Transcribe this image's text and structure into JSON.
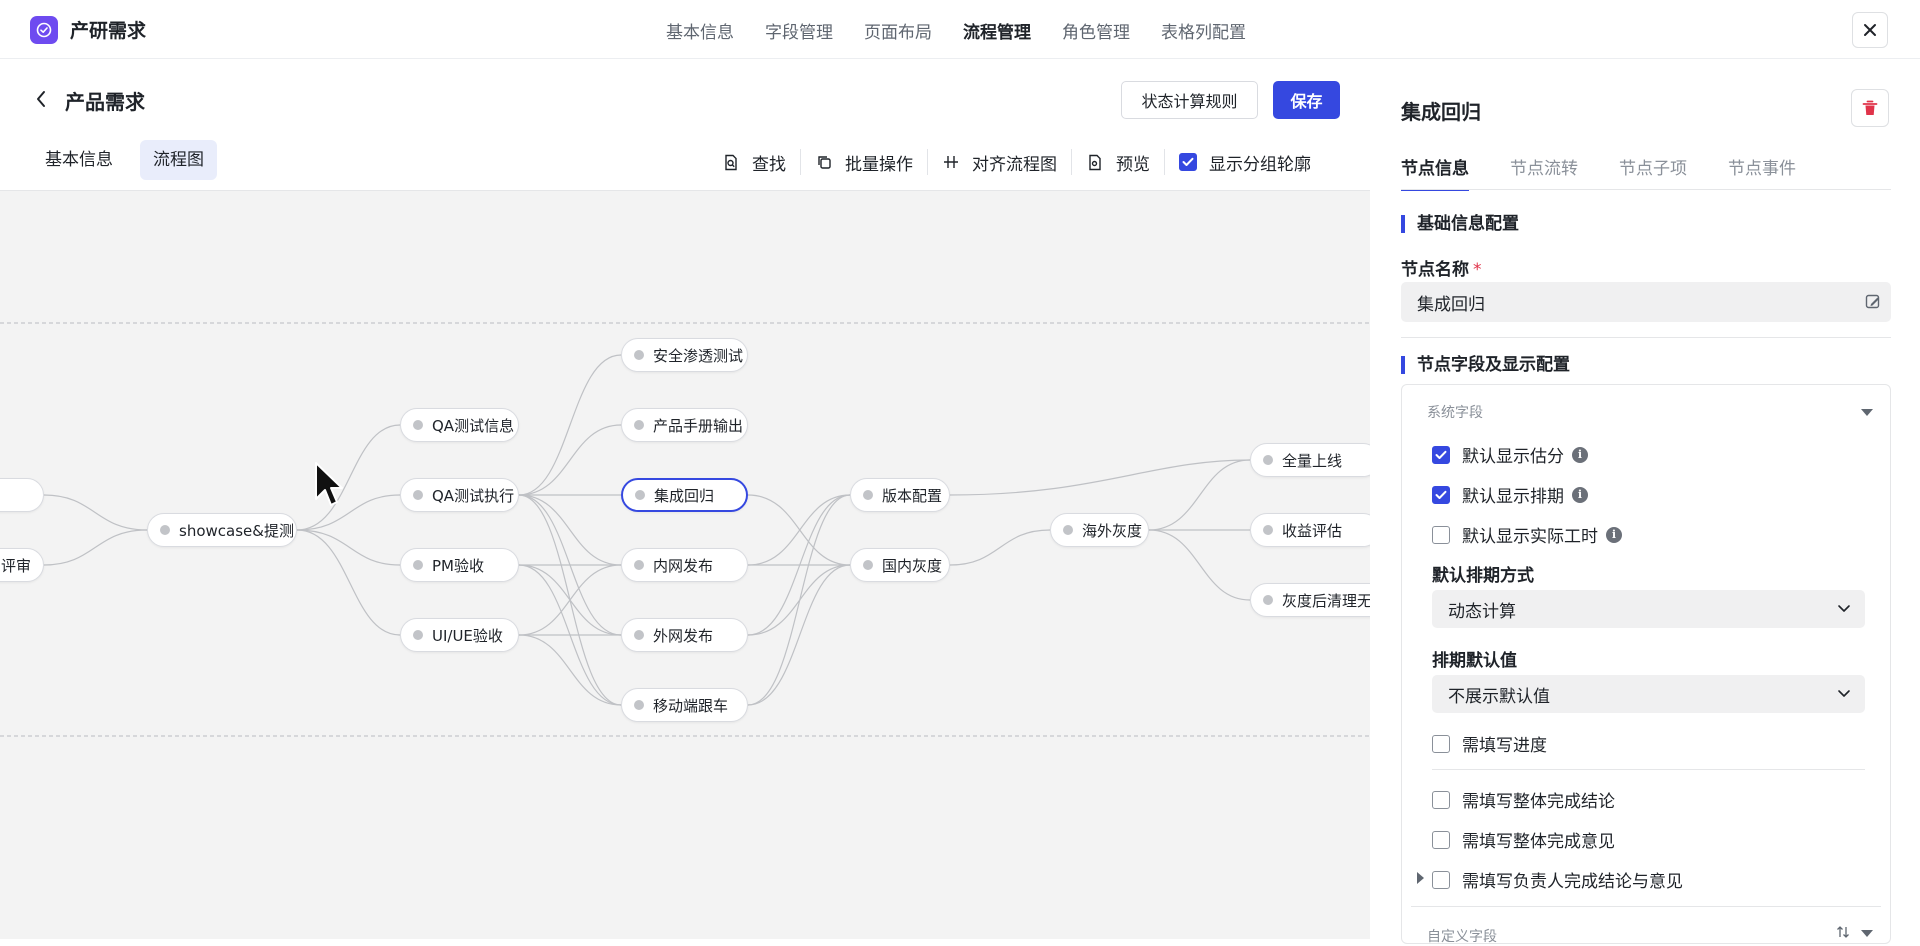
{
  "app": {
    "title": "产研需求",
    "brand_color": "#6e4bf0",
    "accent_color": "#3548e0"
  },
  "top_nav": {
    "items": [
      "基本信息",
      "字段管理",
      "页面布局",
      "流程管理",
      "角色管理",
      "表格列配置"
    ],
    "active_index": 3
  },
  "header": {
    "page_title": "产品需求",
    "state_rule_button": "状态计算规则",
    "save_button": "保存"
  },
  "left_tabs": {
    "items": [
      "基本信息",
      "流程图"
    ],
    "active_index": 1
  },
  "toolbar": {
    "find": "查找",
    "batch": "批量操作",
    "align": "对齐流程图",
    "preview": "预览",
    "show_group_outline": "显示分组轮廓",
    "show_group_outline_checked": true
  },
  "flow": {
    "nodes": [
      {
        "id": "n_left1",
        "label": ""
      },
      {
        "id": "n_left2",
        "label": "评审"
      },
      {
        "id": "showcase",
        "label": "showcase&提测"
      },
      {
        "id": "qa_info",
        "label": "QA测试信息"
      },
      {
        "id": "qa_exec",
        "label": "QA测试执行"
      },
      {
        "id": "pm",
        "label": "PM验收"
      },
      {
        "id": "uiue",
        "label": "UI/UE验收"
      },
      {
        "id": "sec",
        "label": "安全渗透测试"
      },
      {
        "id": "manual",
        "label": "产品手册输出"
      },
      {
        "id": "regress",
        "label": "集成回归"
      },
      {
        "id": "intranet",
        "label": "内网发布"
      },
      {
        "id": "extranet",
        "label": "外网发布"
      },
      {
        "id": "mobile",
        "label": "移动端跟车"
      },
      {
        "id": "version",
        "label": "版本配置"
      },
      {
        "id": "domestic",
        "label": "国内灰度"
      },
      {
        "id": "overseas",
        "label": "海外灰度"
      },
      {
        "id": "full",
        "label": "全量上线"
      },
      {
        "id": "revenue",
        "label": "收益评估"
      },
      {
        "id": "cleanup",
        "label": "灰度后清理无用"
      }
    ],
    "selected": "regress"
  },
  "right_panel": {
    "title": "集成回归",
    "tabs": [
      "节点信息",
      "节点流转",
      "节点子项",
      "节点事件"
    ],
    "active_tab": 0,
    "basic_section": "基础信息配置",
    "node_name_label": "节点名称",
    "required_mark": "*",
    "node_name_value": "集成回归",
    "fields_section": "节点字段及显示配置",
    "system_fields_label": "系统字段",
    "checkboxes": [
      {
        "label": "默认显示估分",
        "checked": true,
        "info": true
      },
      {
        "label": "默认显示排期",
        "checked": true,
        "info": true
      },
      {
        "label": "默认显示实际工时",
        "checked": false,
        "info": true
      }
    ],
    "schedule_mode_label": "默认排期方式",
    "schedule_mode_value": "动态计算",
    "schedule_default_label": "排期默认值",
    "schedule_default_value": "不展示默认值",
    "progress_checkbox": {
      "label": "需填写进度",
      "checked": false
    },
    "more_checkboxes": [
      {
        "label": "需填写整体完成结论",
        "checked": false
      },
      {
        "label": "需填写整体完成意见",
        "checked": false
      },
      {
        "label": "需填写负责人完成结论与意见",
        "checked": false
      }
    ],
    "custom_fields_label": "自定义字段",
    "info_glyph": "i"
  }
}
